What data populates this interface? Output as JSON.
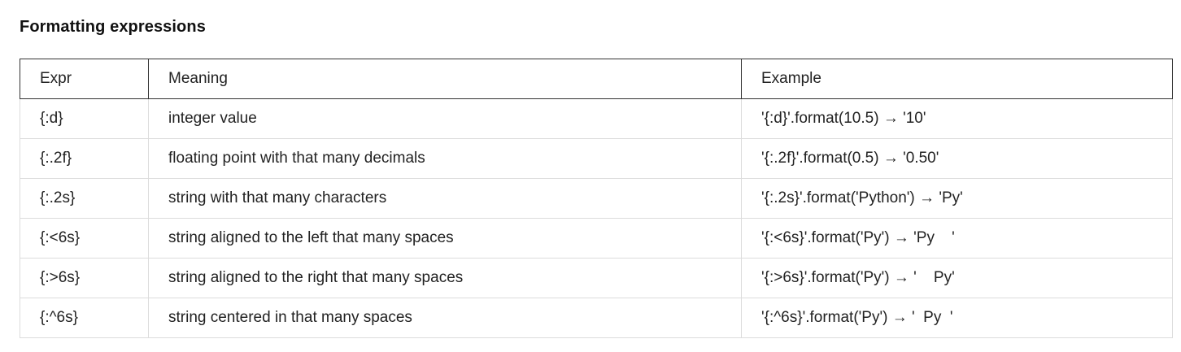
{
  "title": "Formatting expressions",
  "table": {
    "headers": {
      "expr": "Expr",
      "meaning": "Meaning",
      "example": "Example"
    },
    "rows": [
      {
        "expr": "{:d}",
        "meaning": "integer value",
        "example": "'{:d}'.format(10.5) → '10'"
      },
      {
        "expr": "{:.2f}",
        "meaning": "floating point with that many decimals",
        "example": "'{:.2f}'.format(0.5) → '0.50'"
      },
      {
        "expr": "{:.2s}",
        "meaning": "string with that many characters",
        "example": "'{:.2s}'.format('Python') → 'Py'"
      },
      {
        "expr": "{:<6s}",
        "meaning": "string aligned to the left that many spaces",
        "example": "'{:<6s}'.format('Py') → 'Py    '"
      },
      {
        "expr": "{:>6s}",
        "meaning": "string aligned to the right that many spaces",
        "example": "'{:>6s}'.format('Py') → '    Py'"
      },
      {
        "expr": "{:^6s}",
        "meaning": "string centered in that many spaces",
        "example": "'{:^6s}'.format('Py') → '  Py  '"
      }
    ]
  }
}
